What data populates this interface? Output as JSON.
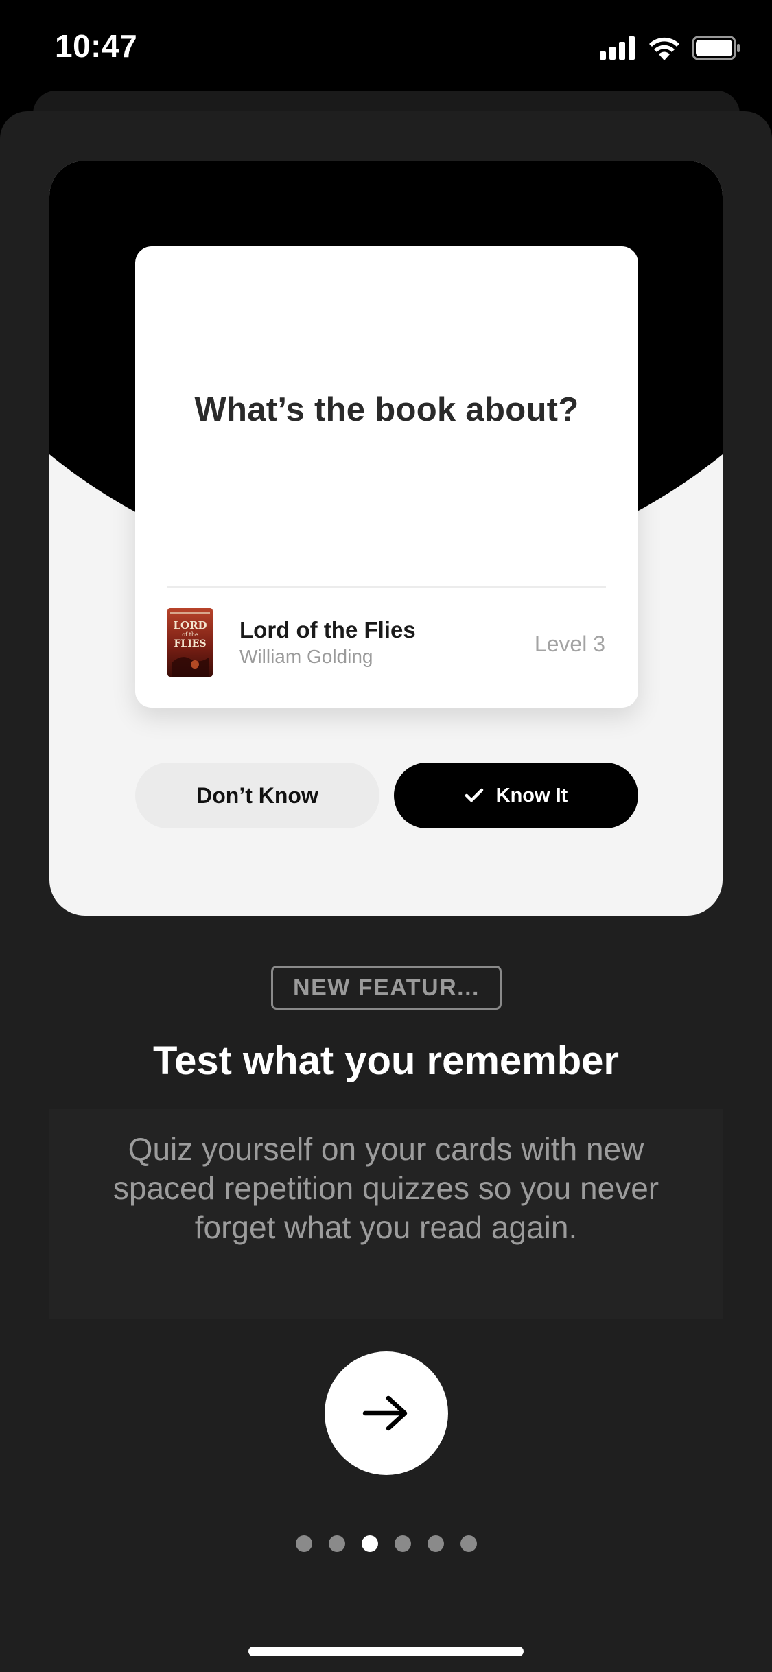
{
  "status_bar": {
    "time": "10:47"
  },
  "quiz_card": {
    "question": "What’s the book about?",
    "book": {
      "title": "Lord of the Flies",
      "author": "William Golding",
      "level": "Level 3",
      "cover_text_top": "WILLIAM GOLDING",
      "cover_text_main": "LORD of the FLIES"
    }
  },
  "actions": {
    "dont_know": "Don’t Know",
    "know_it": "Know It"
  },
  "feature": {
    "badge": "NEW FEATUR...",
    "headline": "Test what you remember",
    "description": "Quiz yourself on your cards with new spaced repetition quizzes so you never forget what you read again."
  },
  "pagination": {
    "total": 6,
    "current": 3
  },
  "colors": {
    "background": "#1f1f1f",
    "accent": "#000000",
    "card": "#ffffff"
  }
}
